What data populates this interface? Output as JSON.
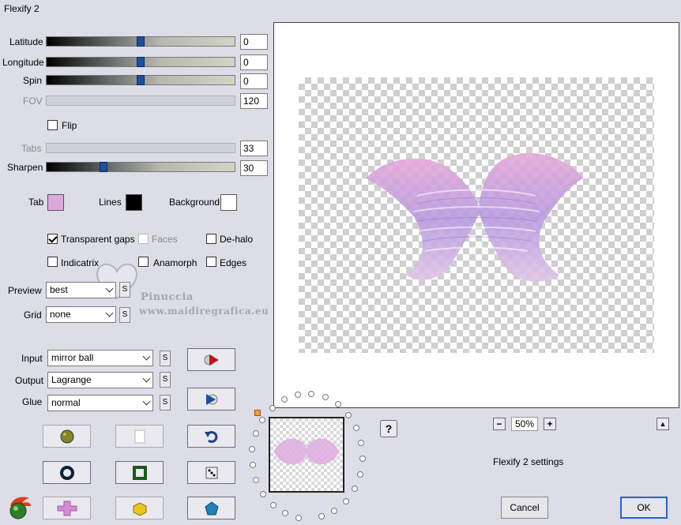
{
  "window": {
    "title": "Flexify 2"
  },
  "sliders": [
    {
      "label": "Latitude",
      "value": "0",
      "enabled": true,
      "level": 0.5
    },
    {
      "label": "Longitude",
      "value": "0",
      "enabled": true,
      "level": 0.5
    },
    {
      "label": "Spin",
      "value": "0",
      "enabled": true,
      "level": 0.5
    },
    {
      "label": "FOV",
      "value": "120",
      "enabled": false
    },
    {
      "label": "Tabs",
      "value": "33",
      "enabled": false
    },
    {
      "label": "Sharpen",
      "value": "30",
      "enabled": true,
      "level": 0.3
    }
  ],
  "flip": {
    "label": "Flip",
    "checked": false
  },
  "colors": {
    "tab": {
      "label": "Tab",
      "value": "#dda9dc"
    },
    "lines": {
      "label": "Lines",
      "value": "#000000"
    },
    "background": {
      "label": "Background",
      "value": "#ffffff"
    }
  },
  "options": {
    "transparent_gaps": {
      "label": "Transparent gaps",
      "checked": true
    },
    "faces": {
      "label": "Faces",
      "checked": false,
      "enabled": false
    },
    "de_halo": {
      "label": "De-halo",
      "checked": false
    },
    "indicatrix": {
      "label": "Indicatrix",
      "checked": false
    },
    "anamorph": {
      "label": "Anamorph",
      "checked": false
    },
    "edges": {
      "label": "Edges",
      "checked": false
    }
  },
  "dropdowns": {
    "preview": {
      "label": "Preview",
      "value": "best"
    },
    "grid": {
      "label": "Grid",
      "value": "none"
    },
    "input": {
      "label": "Input",
      "value": "mirror ball"
    },
    "output": {
      "label": "Output",
      "value": "Lagrange"
    },
    "glue": {
      "label": "Glue",
      "value": "normal"
    },
    "s_label": "S"
  },
  "watermark": {
    "line1": "Pinuccia",
    "line2": "www.maidiregrafica.eu"
  },
  "zoom": {
    "value": "50%",
    "minus": "−",
    "plus": "+"
  },
  "help": {
    "label": "?"
  },
  "collapse": {
    "label": "▲"
  },
  "settings_name": "Flexify 2 settings",
  "buttons": {
    "cancel": "Cancel",
    "ok": "OK"
  },
  "icons": {
    "tool_row1": [
      "globe-icon",
      "blank-page-icon",
      "undo-icon"
    ],
    "tool_row2": [
      "ring-icon",
      "square-frame-icon",
      "dice-icon"
    ],
    "tool_row3": [
      "plus-shape-icon",
      "cube-icon",
      "pentagon-icon"
    ],
    "logo": "flaming-globe-logo-icon",
    "play_red": "play-red-icon",
    "play_blue": "play-blue-icon"
  }
}
